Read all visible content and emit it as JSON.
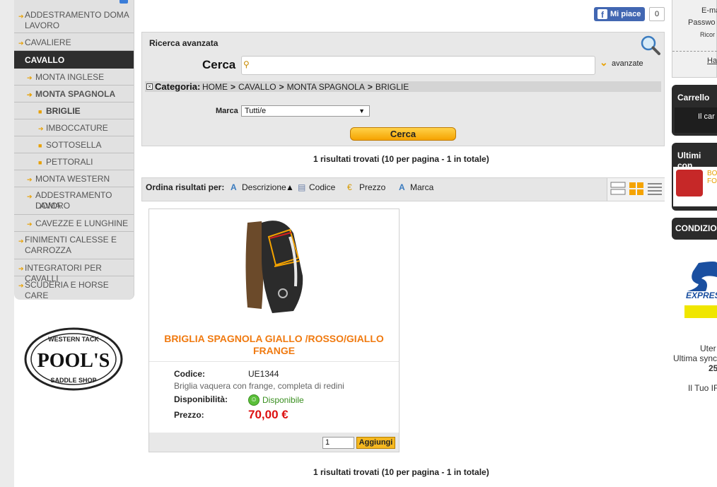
{
  "left_nav": {
    "items": [
      {
        "label": "ADDESTRAMENTO DOMA",
        "label2": "LAVORO"
      },
      {
        "label": "CAVALIERE"
      },
      {
        "label": "CAVALLO"
      },
      {
        "label": "MONTA INGLESE"
      },
      {
        "label": "MONTA SPAGNOLA"
      },
      {
        "label": "BRIGLIE"
      },
      {
        "label": "IMBOCCATURE"
      },
      {
        "label": "SOTTOSELLA"
      },
      {
        "label": "PETTORALI"
      },
      {
        "label": "MONTA WESTERN"
      },
      {
        "label": "ADDESTRAMENTO DOMA",
        "label2": "LAVORO"
      },
      {
        "label": "CAVEZZE E LUNGHINE"
      },
      {
        "label": "FINIMENTI CALESSE E",
        "label2": "CARROZZA"
      },
      {
        "label": "INTEGRATORI PER CAVALLI"
      },
      {
        "label": "SCUDERIA E HORSE CARE"
      }
    ]
  },
  "logo": {
    "top": "WESTERN TACK",
    "main": "POOL'S",
    "bottom": "SADDLE SHOP"
  },
  "facebook": {
    "like_label": "Mi piace",
    "count": "0"
  },
  "search": {
    "title": "Ricerca avanzata",
    "label": "Cerca",
    "input_value": "",
    "advanced_label": "avanzate",
    "category_label": "Categoria:",
    "breadcrumb": [
      "HOME",
      "CAVALLO",
      "MONTA SPAGNOLA",
      "BRIGLIE"
    ],
    "brand_label": "Marca",
    "brand_selected": "Tutti/e",
    "button_label": "Cerca"
  },
  "results_text": "1 risultati trovati (10 per pagina - 1 in totale)",
  "sort": {
    "label": "Ordina risultati per:",
    "options": [
      "Descrizione",
      "Codice",
      "Prezzo",
      "Marca"
    ]
  },
  "product": {
    "title": "BRIGLIA SPAGNOLA GIALLO /ROSSO/GIALLO FRANGE",
    "code_label": "Codice:",
    "code": "UE1344",
    "description": "Briglia vaquera con frange, completa di redini",
    "availability_label": "Disponibilità:",
    "availability": "Disponibile",
    "price_label": "Prezzo:",
    "price": "70,00 €",
    "quantity": "1",
    "add_label": "Aggiungi"
  },
  "right_panel": {
    "login_lines": [
      "E-ma",
      "Passwo",
      "Ricor",
      "Ha"
    ],
    "cart_title": "Carrello",
    "cart_text": "Il car",
    "latest_title": "Ultimi con",
    "latest_item": [
      "BO",
      "FO"
    ],
    "conditions_title": "CONDIZIO",
    "express_text": "EXPRES",
    "footer_lines": [
      "Uter",
      "Ultima sync",
      "25",
      "Il Tuo IF"
    ]
  },
  "colors": {
    "accent": "#f07a10",
    "price": "#dd1111",
    "button": "#f5a300",
    "available": "#3a8f20"
  }
}
